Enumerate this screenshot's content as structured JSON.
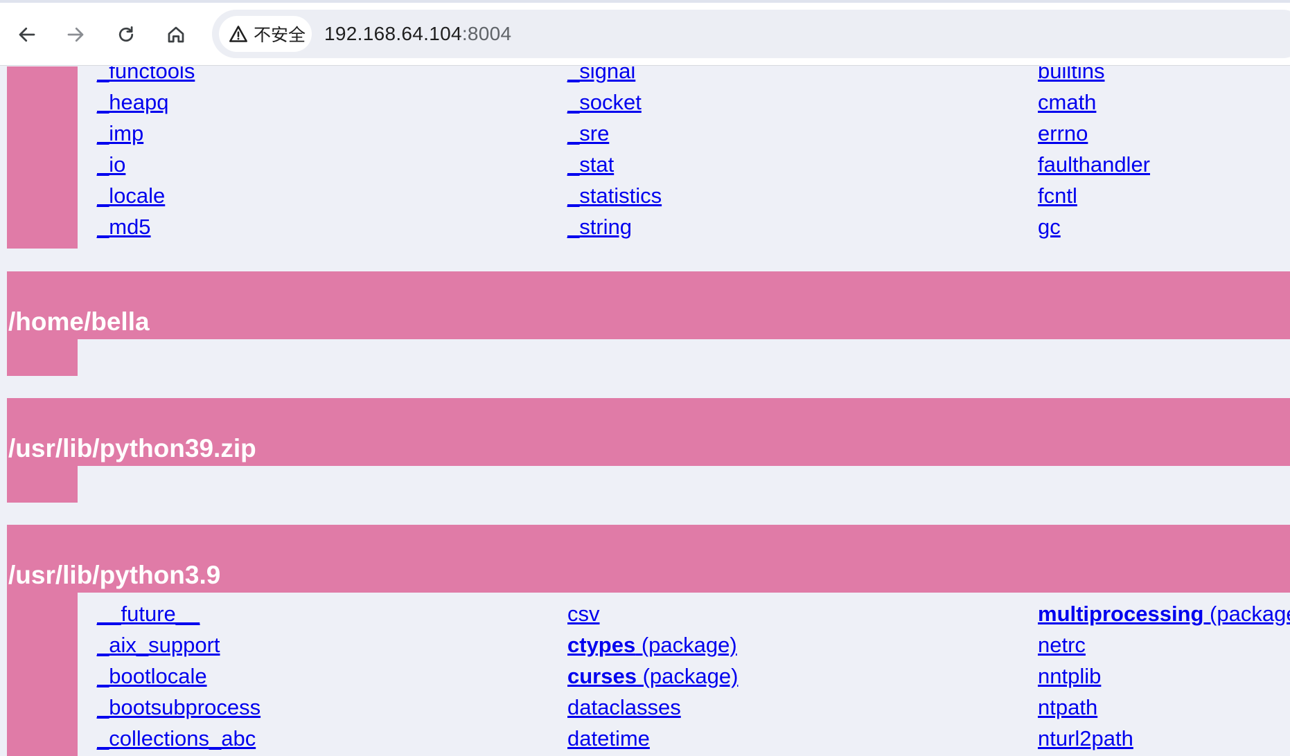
{
  "browser": {
    "security_label": "不安全",
    "url_host": "192.168.64.104",
    "url_port": ":8004"
  },
  "top_list": {
    "col1": [
      "_functools",
      "_heapq",
      "_imp",
      "_io",
      "_locale",
      "_md5"
    ],
    "col2": [
      "_signal",
      "_socket",
      "_sre",
      "_stat",
      "_statistics",
      "_string"
    ],
    "col3": [
      "builtins",
      "cmath",
      "errno",
      "faulthandler",
      "fcntl",
      "gc"
    ]
  },
  "sections": [
    {
      "title": "/home/bella"
    },
    {
      "title": "/usr/lib/python39.zip"
    },
    {
      "title": "/usr/lib/python3.9"
    }
  ],
  "bottom_list": {
    "col1": [
      {
        "name": "__future__",
        "suffix": ""
      },
      {
        "name": "_aix_support",
        "suffix": ""
      },
      {
        "name": "_bootlocale",
        "suffix": ""
      },
      {
        "name": "_bootsubprocess",
        "suffix": ""
      },
      {
        "name": "_collections_abc",
        "suffix": ""
      }
    ],
    "col2": [
      {
        "name": "csv",
        "suffix": ""
      },
      {
        "name": "ctypes",
        "suffix": " (package)"
      },
      {
        "name": "curses",
        "suffix": " (package)"
      },
      {
        "name": "dataclasses",
        "suffix": ""
      },
      {
        "name": "datetime",
        "suffix": ""
      }
    ],
    "col3": [
      {
        "name": "multiprocessing",
        "suffix": " (package)"
      },
      {
        "name": "netrc",
        "suffix": ""
      },
      {
        "name": "nntplib",
        "suffix": ""
      },
      {
        "name": "ntpath",
        "suffix": ""
      },
      {
        "name": "nturl2path",
        "suffix": ""
      }
    ]
  },
  "colors": {
    "header_bg": "#e07ba7",
    "page_bg": "#eef0f7",
    "link": "#0000ee"
  }
}
